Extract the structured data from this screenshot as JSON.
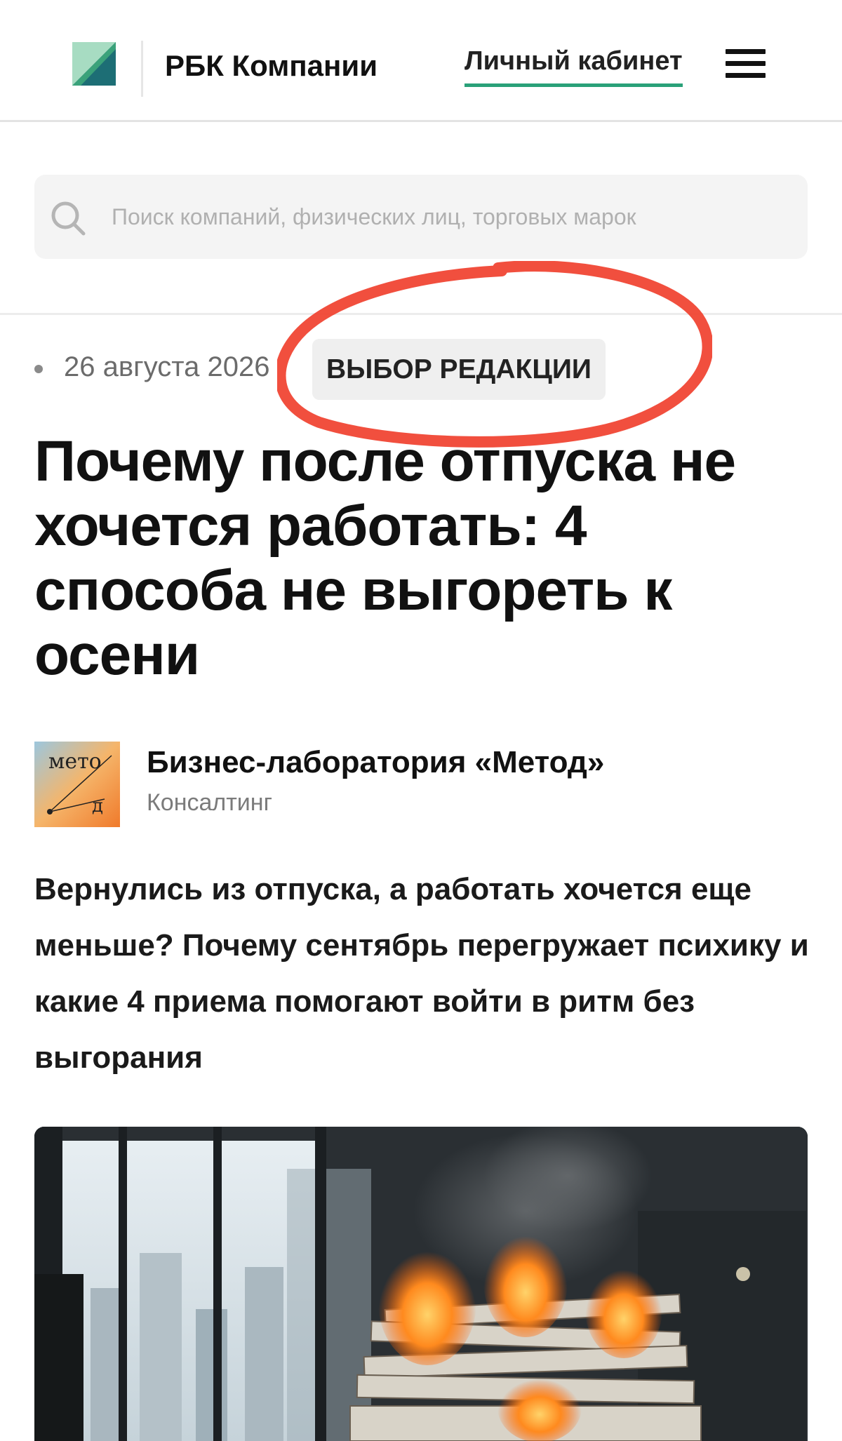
{
  "header": {
    "brand": "РБК Компании",
    "cabinet_link": "Личный кабинет",
    "logo_colors": {
      "green": "#3aa27a",
      "teal": "#1d6e75",
      "light": "#a7dcc2"
    },
    "accent_color": "#2aa179"
  },
  "search": {
    "placeholder": "Поиск компаний, физических лиц, торговых марок",
    "value": ""
  },
  "article": {
    "date": "26 августа 2026",
    "badge": "ВЫБОР РЕДАКЦИИ",
    "title": "Почему после отпуска не хочется работать: 4 способа не выгореть к осени",
    "author": {
      "name": "Бизнес-лаборатория «Метод»",
      "category": "Консалтинг",
      "logo_text": "мето д"
    },
    "lead": "Вернулись из отпуска, а работать хочется еще меньше? Почему сентябрь перегружает психику и какие 4 приема помогают войти в ритм без выгорания",
    "image": {
      "description_icon": "burning-papers-image"
    }
  },
  "annotation": {
    "circle_color": "#f0402e"
  },
  "icons": [
    "logo-icon",
    "search-icon",
    "menu-icon"
  ]
}
